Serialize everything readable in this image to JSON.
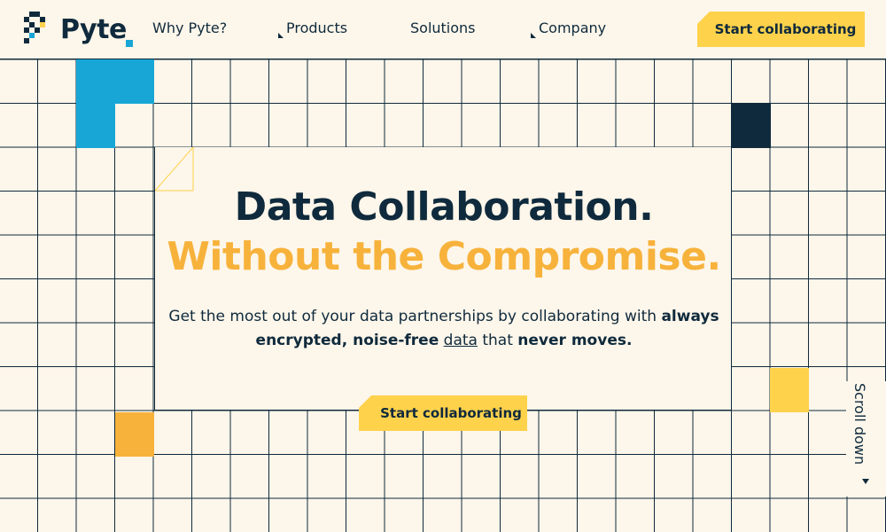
{
  "brand": {
    "name": "Pyte"
  },
  "nav": [
    {
      "label": "Why Pyte?",
      "has_caret": false
    },
    {
      "label": "Products",
      "has_caret": true
    },
    {
      "label": "Solutions",
      "has_caret": false
    },
    {
      "label": "Company",
      "has_caret": true
    }
  ],
  "header_cta": {
    "label": "Start collaborating"
  },
  "hero": {
    "title_line1": "Data Collaboration.",
    "title_line2": "Without the Compromise.",
    "desc_part1": "Get the most out of your data partnerships by collaborating with ",
    "desc_bold1": "always encrypted, noise-free",
    "desc_space": " ",
    "desc_link": "data",
    "desc_part2": " that ",
    "desc_bold2": "never moves.",
    "cta_label": "Start collaborating"
  },
  "scroll": {
    "label": "Scroll down",
    "icon": "caret-down-icon"
  },
  "colors": {
    "navy": "#0f2a3c",
    "cream": "#fdf6ea",
    "yellow": "#ffd24c",
    "orange": "#f7b23b",
    "blue": "#18a6d6"
  }
}
